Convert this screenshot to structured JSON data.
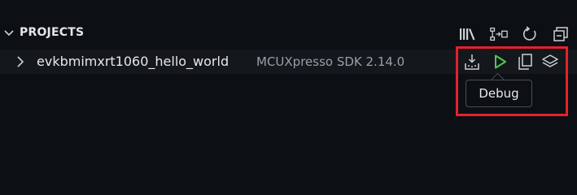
{
  "panel": {
    "title": "PROJECTS",
    "header_actions": [
      "library-icon",
      "import-icon",
      "refresh-icon",
      "collapse-all-icon"
    ]
  },
  "project": {
    "name": "evkbmimxrt1060_hello_world",
    "sdk": "MCUXpresso SDK 2.14.0",
    "actions": [
      "build-icon",
      "debug-icon",
      "copy-icon",
      "layers-icon"
    ]
  },
  "tooltip": {
    "text": "Debug"
  },
  "colors": {
    "background": "#0c0f14",
    "debug_green": "#4ec94e",
    "highlight_red": "#e8202a"
  }
}
